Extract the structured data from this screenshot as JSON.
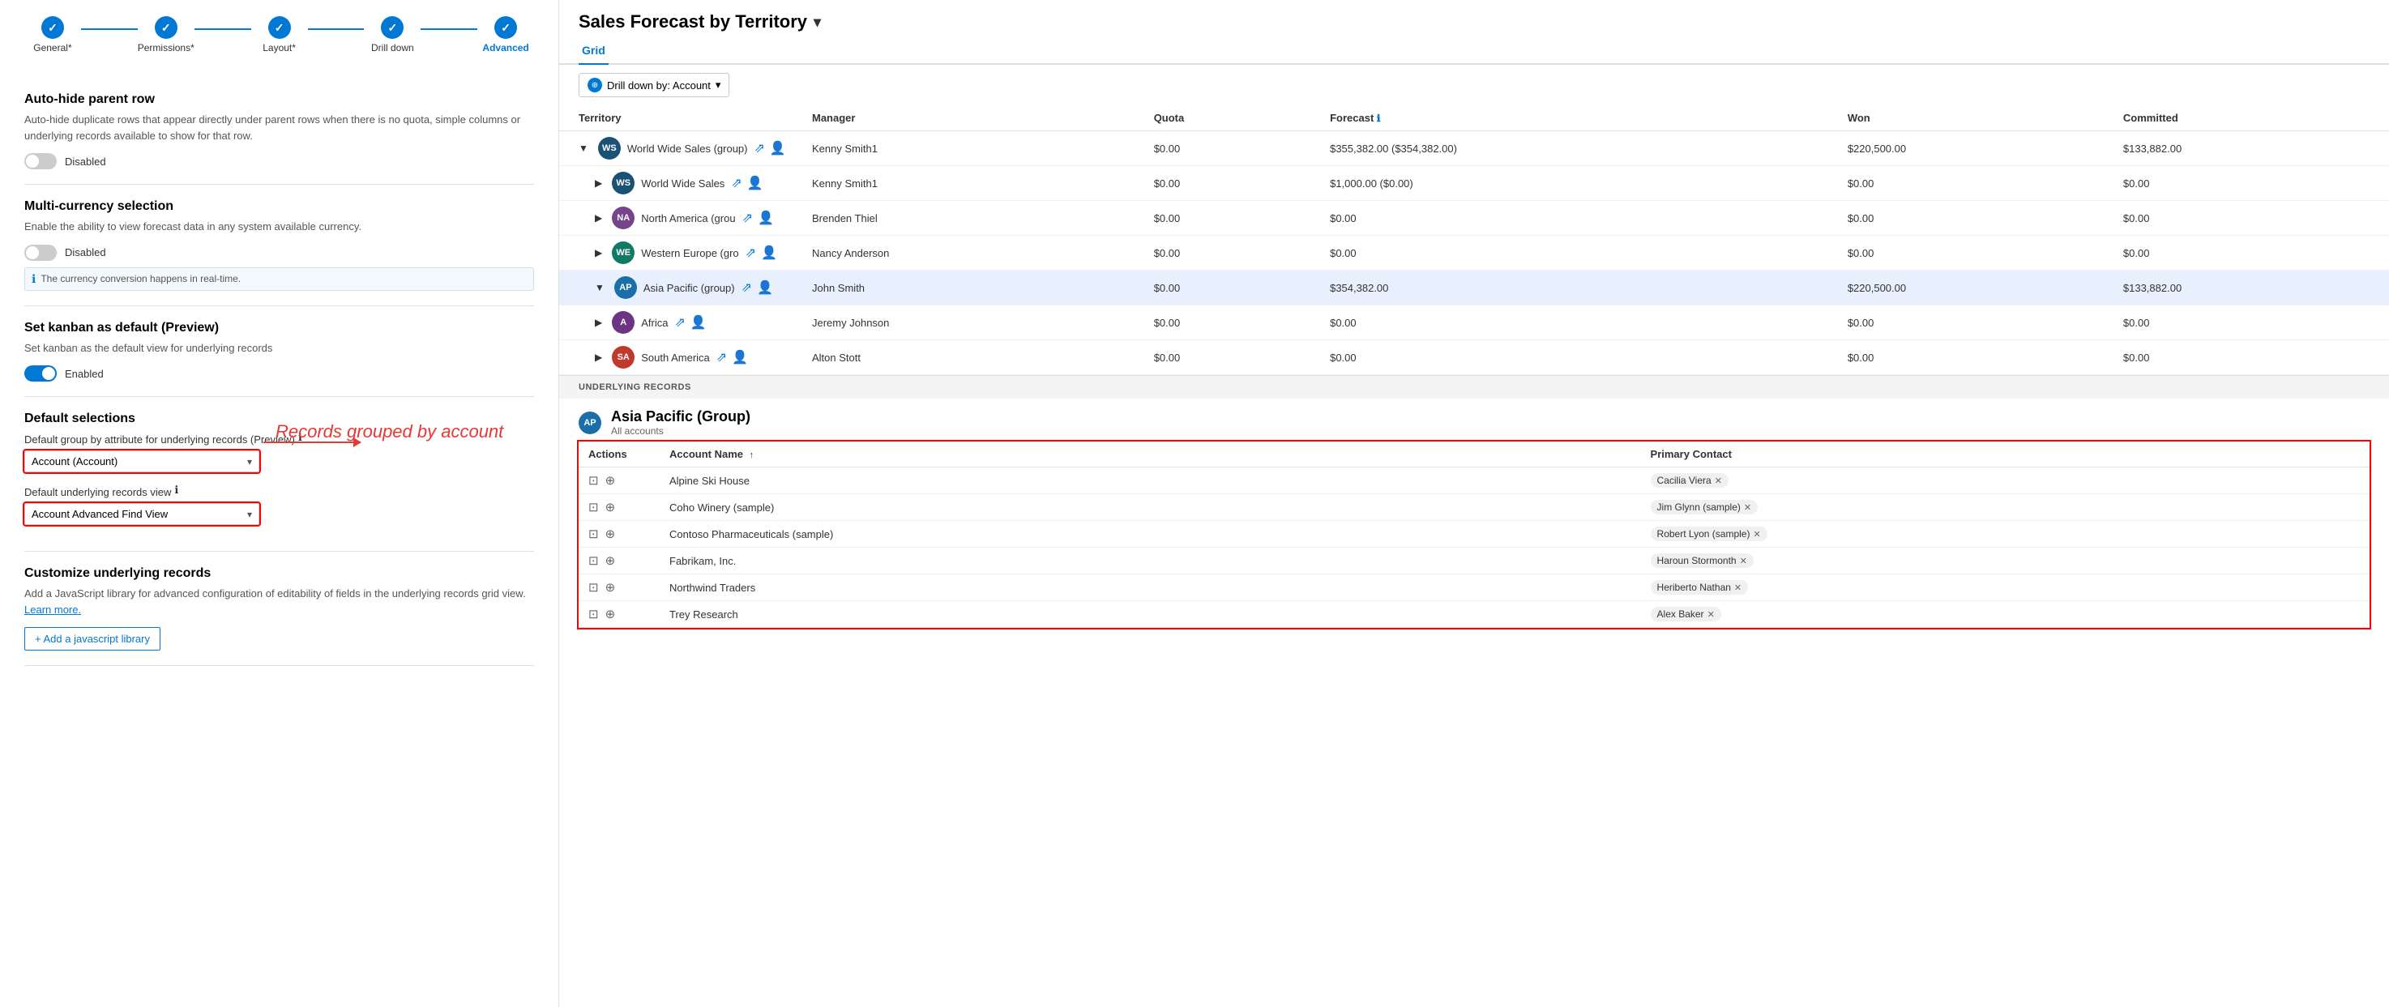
{
  "stepper": {
    "steps": [
      {
        "label": "General*",
        "active": false
      },
      {
        "label": "Permissions*",
        "active": false
      },
      {
        "label": "Layout*",
        "active": false
      },
      {
        "label": "Drill down",
        "active": false
      },
      {
        "label": "Advanced",
        "active": true
      }
    ]
  },
  "autohide": {
    "title": "Auto-hide parent row",
    "desc": "Auto-hide duplicate rows that appear directly under parent rows when there is no quota, simple columns or underlying records available to show for that row.",
    "toggle": "Disabled",
    "enabled": false
  },
  "multicurrency": {
    "title": "Multi-currency selection",
    "desc": "Enable the ability to view forecast data in any system available currency.",
    "toggle": "Disabled",
    "enabled": false,
    "note": "The currency conversion happens in real-time."
  },
  "kanban": {
    "title": "Set kanban as default (Preview)",
    "desc": "Set kanban as the default view for underlying records",
    "toggle": "Enabled",
    "enabled": true
  },
  "default_selections": {
    "title": "Default selections",
    "group_label": "Default group by attribute for underlying records (Preview)",
    "group_value": "Account (Account)",
    "view_label": "Default underlying records view",
    "view_value": "Account Advanced Find View"
  },
  "customize": {
    "title": "Customize underlying records",
    "desc": "Add a JavaScript library for advanced configuration of editability of fields in the underlying records grid view.",
    "learn_more": "Learn more.",
    "add_btn": "+ Add a javascript library"
  },
  "annotation": {
    "text": "Records grouped by account"
  },
  "forecast": {
    "title": "Sales Forecast by Territory",
    "active_tab": "Grid",
    "tabs": [
      "Grid"
    ],
    "drilldown_btn": "Drill down by: Account",
    "columns": [
      "Territory",
      "Manager",
      "Quota",
      "Forecast",
      "Won",
      "Committed"
    ],
    "rows": [
      {
        "indent": 0,
        "expand": true,
        "avatar_bg": "#1a5276",
        "avatar_text": "WS",
        "name": "World Wide Sales (group)",
        "manager": "Kenny Smith1",
        "quota": "$0.00",
        "forecast": "$355,382.00 ($354,382.00)",
        "won": "$220,500.00",
        "committed": "$133,882.00",
        "highlighted": false
      },
      {
        "indent": 1,
        "expand": false,
        "avatar_bg": "#1a5276",
        "avatar_text": "WS",
        "name": "World Wide Sales",
        "manager": "Kenny Smith1",
        "quota": "$0.00",
        "forecast": "$1,000.00 ($0.00)",
        "won": "$0.00",
        "committed": "$0.00",
        "highlighted": false
      },
      {
        "indent": 1,
        "expand": false,
        "avatar_bg": "#76448a",
        "avatar_text": "NA",
        "name": "North America (grou",
        "manager": "Brenden Thiel",
        "quota": "$0.00",
        "forecast": "$0.00",
        "won": "$0.00",
        "committed": "$0.00",
        "highlighted": false
      },
      {
        "indent": 1,
        "expand": false,
        "avatar_bg": "#117a65",
        "avatar_text": "WE",
        "name": "Western Europe (gro",
        "manager": "Nancy Anderson",
        "quota": "$0.00",
        "forecast": "$0.00",
        "won": "$0.00",
        "committed": "$0.00",
        "highlighted": false
      },
      {
        "indent": 1,
        "expand": true,
        "avatar_bg": "#1a6fa8",
        "avatar_text": "AP",
        "name": "Asia Pacific (group)",
        "manager": "John Smith",
        "quota": "$0.00",
        "forecast": "$354,382.00",
        "won": "$220,500.00",
        "committed": "$133,882.00",
        "highlighted": true
      },
      {
        "indent": 1,
        "expand": false,
        "avatar_bg": "#6c3483",
        "avatar_text": "A",
        "name": "Africa",
        "manager": "Jeremy Johnson",
        "quota": "$0.00",
        "forecast": "$0.00",
        "won": "$0.00",
        "committed": "$0.00",
        "highlighted": false
      },
      {
        "indent": 1,
        "expand": false,
        "avatar_bg": "#c0392b",
        "avatar_text": "SA",
        "name": "South America",
        "manager": "Alton Stott",
        "quota": "$0.00",
        "forecast": "$0.00",
        "won": "$0.00",
        "committed": "$0.00",
        "highlighted": false
      }
    ],
    "underlying_header": "UNDERLYING RECORDS",
    "underlying_avatar_bg": "#1a6fa8",
    "underlying_avatar_text": "AP",
    "underlying_title": "Asia Pacific (Group)",
    "underlying_subtitle": "All accounts",
    "records_columns": [
      "Actions",
      "Account Name ↑",
      "Primary Contact"
    ],
    "records": [
      {
        "account": "Alpine Ski House",
        "contact": "Cacilia Viera"
      },
      {
        "account": "Coho Winery (sample)",
        "contact": "Jim Glynn (sample)"
      },
      {
        "account": "Contoso Pharmaceuticals (sample)",
        "contact": "Robert Lyon (sample)"
      },
      {
        "account": "Fabrikam, Inc.",
        "contact": "Haroun Stormonth"
      },
      {
        "account": "Northwind Traders",
        "contact": "Heriberto Nathan"
      },
      {
        "account": "Trey Research",
        "contact": "Alex Baker"
      }
    ]
  }
}
